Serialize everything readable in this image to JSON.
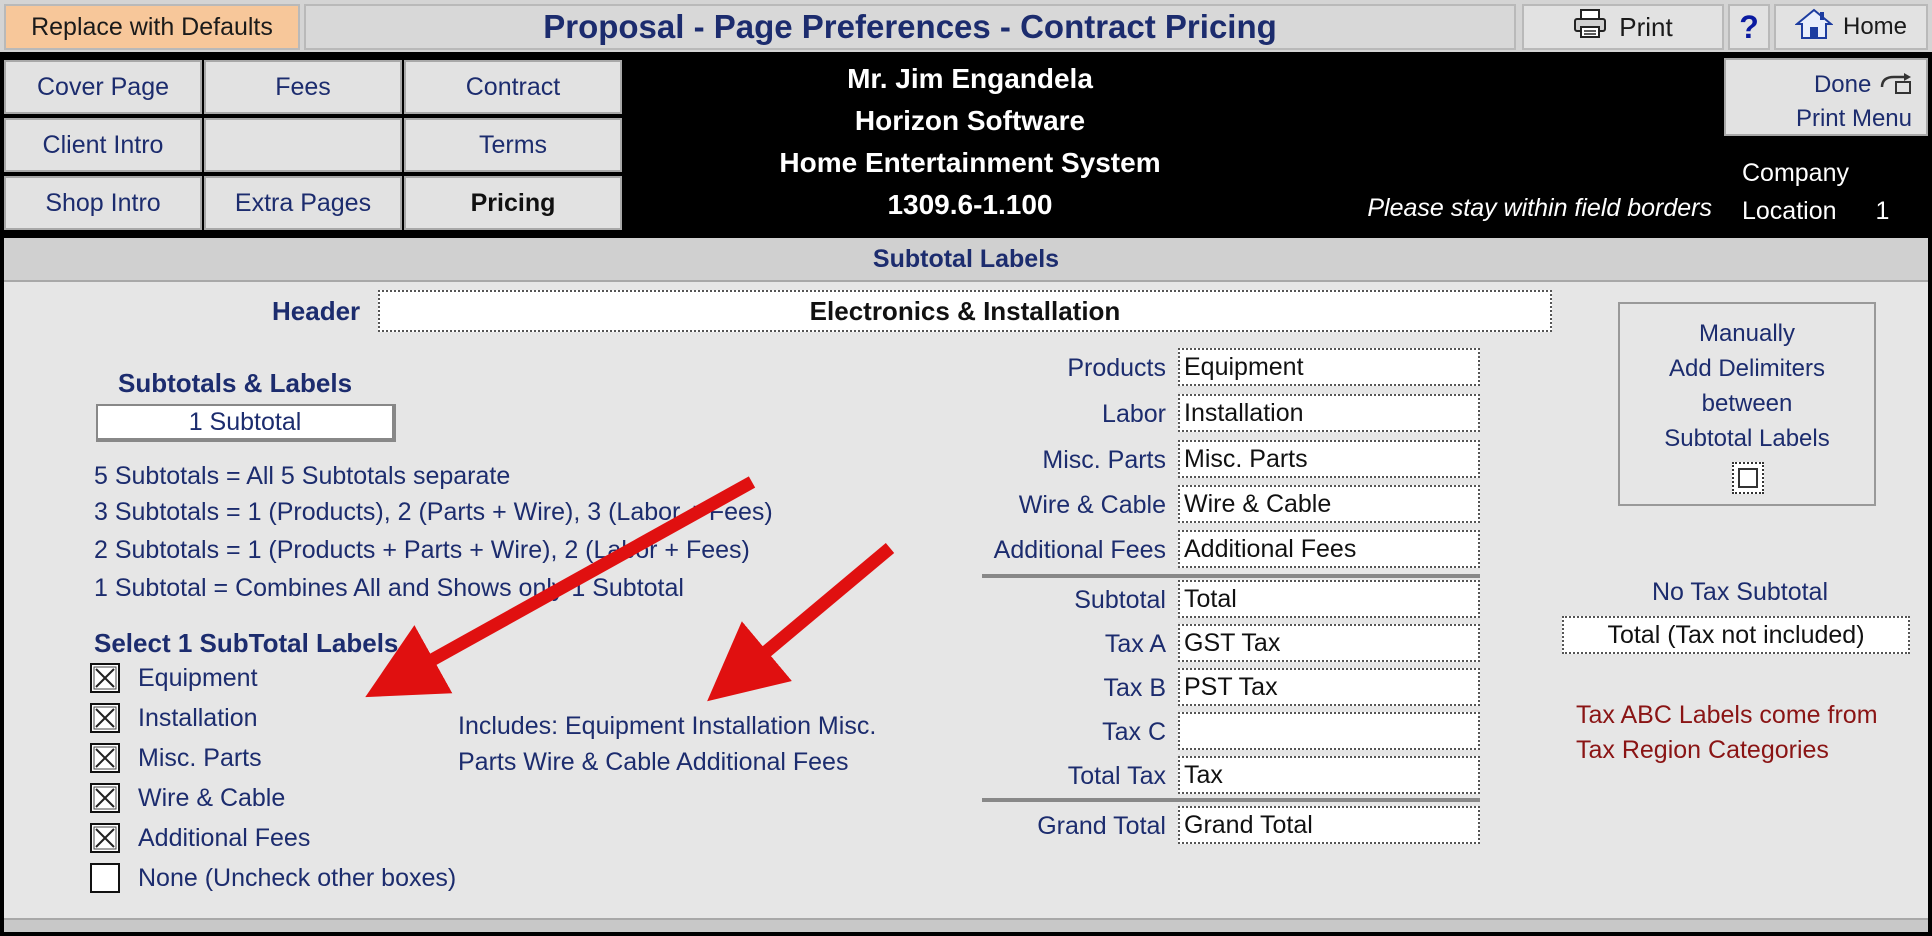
{
  "topbar": {
    "defaults_label": "Replace with Defaults",
    "title": "Proposal - Page Preferences - Contract Pricing",
    "print_label": "Print",
    "help_label": "?",
    "home_label": "Home"
  },
  "nav": {
    "cover_page": "Cover Page",
    "fees": "Fees",
    "contract": "Contract",
    "client_intro": "Client Intro",
    "terms": "Terms",
    "shop_intro": "Shop Intro",
    "extra_pages": "Extra Pages",
    "pricing": "Pricing"
  },
  "client": {
    "name": "Mr. Jim Engandela",
    "company": "Horizon Software",
    "project": "Home Entertainment System",
    "number": "1309.6-1.100"
  },
  "header_note": "Please stay within field borders",
  "done": {
    "line1": "Done",
    "line2": "Print Menu"
  },
  "location": {
    "company_label": "Company",
    "location_label": "Location",
    "location_value": "1"
  },
  "section": {
    "title": "Subtotal Labels"
  },
  "header_field": {
    "label": "Header",
    "value": "Electronics & Installation"
  },
  "subtotals": {
    "heading": "Subtotals & Labels",
    "selected": "1 Subtotal",
    "options": [
      "5  Subtotals = All 5 Subtotals separate",
      "3  Subtotals = 1 (Products),  2 (Parts + Wire),  3 (Labor + Fees)",
      "2  Subtotals = 1 (Products + Parts + Wire),  2 (Labor + Fees)",
      "1  Subtotal   = Combines All and Shows only 1 Subtotal"
    ]
  },
  "select_labels": {
    "heading": "Select 1 SubTotal Labels",
    "items": [
      {
        "label": "Equipment",
        "checked": true
      },
      {
        "label": "Installation",
        "checked": true
      },
      {
        "label": "Misc. Parts",
        "checked": true
      },
      {
        "label": "Wire & Cable",
        "checked": true
      },
      {
        "label": "Additional Fees",
        "checked": true
      },
      {
        "label": "None (Uncheck other boxes)",
        "checked": false
      }
    ]
  },
  "includes": {
    "line1": "Includes: Equipment  Installation  Misc.",
    "line2": "Parts  Wire & Cable  Additional Fees"
  },
  "labels": {
    "products": {
      "label": "Products",
      "value": "Equipment"
    },
    "labor": {
      "label": "Labor",
      "value": "Installation"
    },
    "misc_parts": {
      "label": "Misc. Parts",
      "value": "Misc. Parts"
    },
    "wire_cable": {
      "label": "Wire & Cable",
      "value": "Wire & Cable"
    },
    "additional_fees": {
      "label": "Additional Fees",
      "value": "Additional Fees"
    },
    "subtotal": {
      "label": "Subtotal",
      "value": "Total"
    },
    "tax_a": {
      "label": "Tax A",
      "value": "GST Tax"
    },
    "tax_b": {
      "label": "Tax B",
      "value": "PST Tax"
    },
    "tax_c": {
      "label": "Tax C",
      "value": ""
    },
    "total_tax": {
      "label": "Total Tax",
      "value": "Tax"
    },
    "grand_total": {
      "label": "Grand Total",
      "value": "Grand Total"
    }
  },
  "delimiters": {
    "line1": "Manually",
    "line2": "Add Delimiters",
    "line3": "between",
    "line4": "Subtotal Labels",
    "checked": false
  },
  "no_tax": {
    "label": "No Tax Subtotal",
    "value": "Total (Tax not included)"
  },
  "tax_note": {
    "line1": "Tax ABC Labels come from",
    "line2": "Tax Region Categories"
  },
  "colors": {
    "accent_orange": "#f7c79a",
    "title_navy": "#1c2c6e",
    "arrow_red": "#e01010",
    "note_red": "#8a1414"
  }
}
